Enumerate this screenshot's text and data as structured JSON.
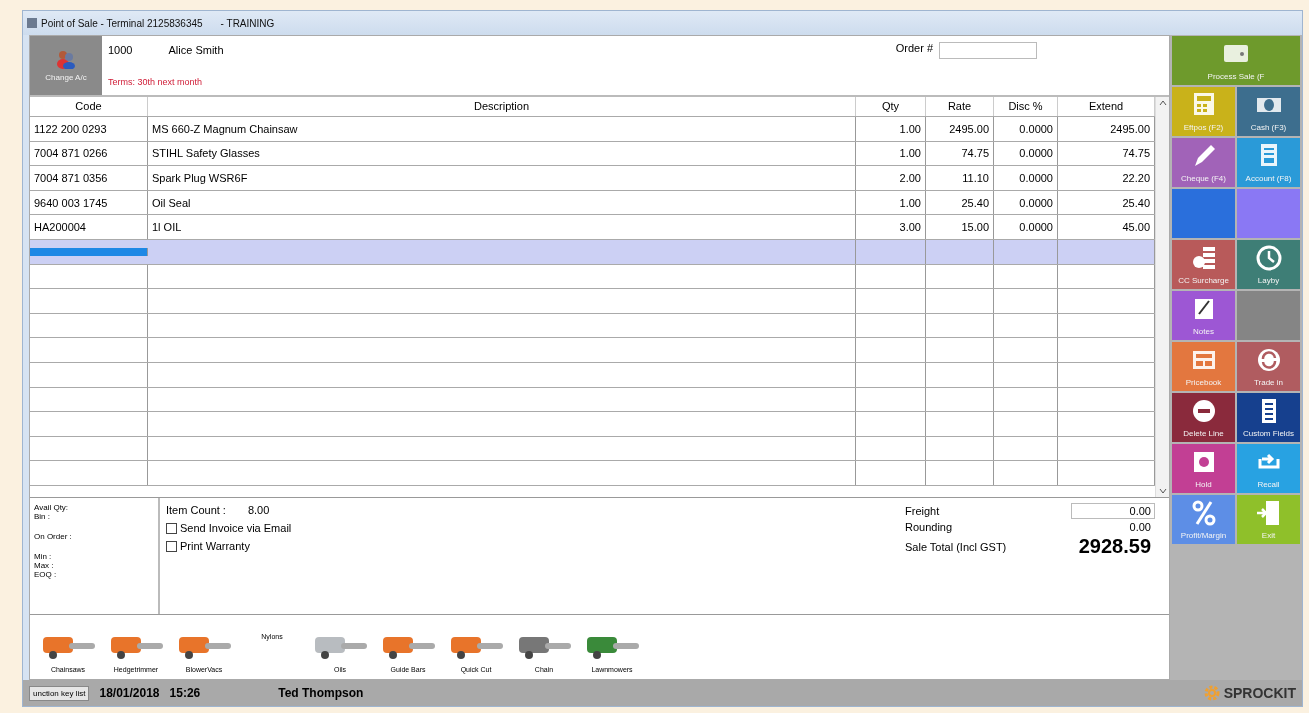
{
  "window": {
    "title": "Point of Sale - Terminal 2125836345",
    "mode": "- TRAINING"
  },
  "customer": {
    "button": "Change A/c",
    "account": "1000",
    "name": "Alice Smith",
    "terms": "Terms: 30th next month",
    "order_label": "Order #"
  },
  "table": {
    "columns": [
      "Code",
      "Description",
      "Qty",
      "Rate",
      "Disc %",
      "Extend"
    ],
    "rows": [
      {
        "selected": false,
        "cells": [
          "1122 200 0293",
          "MS 660-Z Magnum Chainsaw",
          "1.00",
          "2495.00",
          "0.0000",
          "2495.00"
        ]
      },
      {
        "selected": false,
        "cells": [
          "7004 871 0266",
          "STIHL Safety Glasses",
          "1.00",
          "74.75",
          "0.0000",
          "74.75"
        ]
      },
      {
        "selected": false,
        "cells": [
          "7004 871 0356",
          "Spark Plug WSR6F",
          "2.00",
          "11.10",
          "0.0000",
          "22.20"
        ]
      },
      {
        "selected": false,
        "cells": [
          "9640 003 1745",
          "Oil Seal",
          "1.00",
          "25.40",
          "0.0000",
          "25.40"
        ]
      },
      {
        "selected": false,
        "cells": [
          "HA200004",
          "1l OIL",
          "3.00",
          "15.00",
          "0.0000",
          "45.00"
        ]
      },
      {
        "selected": true,
        "cells": []
      }
    ]
  },
  "stock_labels": [
    "Avail Qty:",
    "Bin :",
    "On Order :",
    "Min :",
    "Max :",
    "EOQ :"
  ],
  "item_count": {
    "label": "Item Count :",
    "value": "8.00"
  },
  "options": [
    {
      "label": "Send Invoice via Email",
      "checked": false
    },
    {
      "label": "Print Warranty",
      "checked": false
    }
  ],
  "totals": {
    "freight_label": "Freight",
    "freight": "0.00",
    "rounding_label": "Rounding",
    "rounding": "0.00",
    "total_label": "Sale Total (Incl GST)",
    "total": "2928.59"
  },
  "shortcuts": [
    {
      "label": "Chainsaws",
      "kind": "image"
    },
    {
      "label": "Hedgetrimmer",
      "kind": "image"
    },
    {
      "label": "BlowerVacs",
      "kind": "image"
    },
    {
      "label": "Nylons",
      "kind": "text"
    },
    {
      "label": "Oils",
      "kind": "image"
    },
    {
      "label": "Guide Bars",
      "kind": "image"
    },
    {
      "label": "Quick Cut",
      "kind": "image"
    },
    {
      "label": "Chain",
      "kind": "image"
    },
    {
      "label": "Lawnmowers",
      "kind": "image"
    }
  ],
  "tiles": [
    {
      "label": "Process Sale (F",
      "kind": "wide",
      "color": "#6e9a2c"
    },
    {
      "label": "Eftpos (F2)",
      "kind": "tile",
      "color": "#c9b21a"
    },
    {
      "label": "Cash (F3)",
      "kind": "tile",
      "color": "#3d6e8e"
    },
    {
      "label": "Cheque (F4)",
      "kind": "tile",
      "color": "#a163b8"
    },
    {
      "label": "Account (F8)",
      "kind": "tile",
      "color": "#2a9ad8"
    },
    {
      "kind": "blank",
      "color": "#2a6fdc"
    },
    {
      "kind": "blank",
      "color": "#8a78f4"
    },
    {
      "label": "CC Surcharge",
      "kind": "tile",
      "color": "#b85a5a"
    },
    {
      "label": "Layby",
      "kind": "tile",
      "color": "#3e7e76"
    },
    {
      "label": "Notes",
      "kind": "tile",
      "color": "#9d57d4"
    },
    {
      "kind": "blank",
      "color": "#858585"
    },
    {
      "label": "Pricebook",
      "kind": "tile",
      "color": "#e3773f"
    },
    {
      "label": "Trade in",
      "kind": "tile",
      "color": "#b05c60"
    },
    {
      "label": "Delete Line",
      "kind": "tile",
      "color": "#8a2a3c"
    },
    {
      "label": "Custom Fields",
      "kind": "tile",
      "color": "#16408e"
    },
    {
      "label": "Hold",
      "kind": "tile",
      "color": "#c23f94"
    },
    {
      "label": "Recall",
      "kind": "tile",
      "color": "#28a2e2"
    },
    {
      "label": "Profit/Margin",
      "kind": "tile",
      "color": "#5d8ee6"
    },
    {
      "label": "Exit",
      "kind": "tile",
      "color": "#8fc02a"
    }
  ],
  "status_bar": {
    "button": "unction key list",
    "date": "18/01/2018",
    "time": "15:26",
    "user": "Ted Thompson"
  },
  "brand": "SPROCKIT"
}
